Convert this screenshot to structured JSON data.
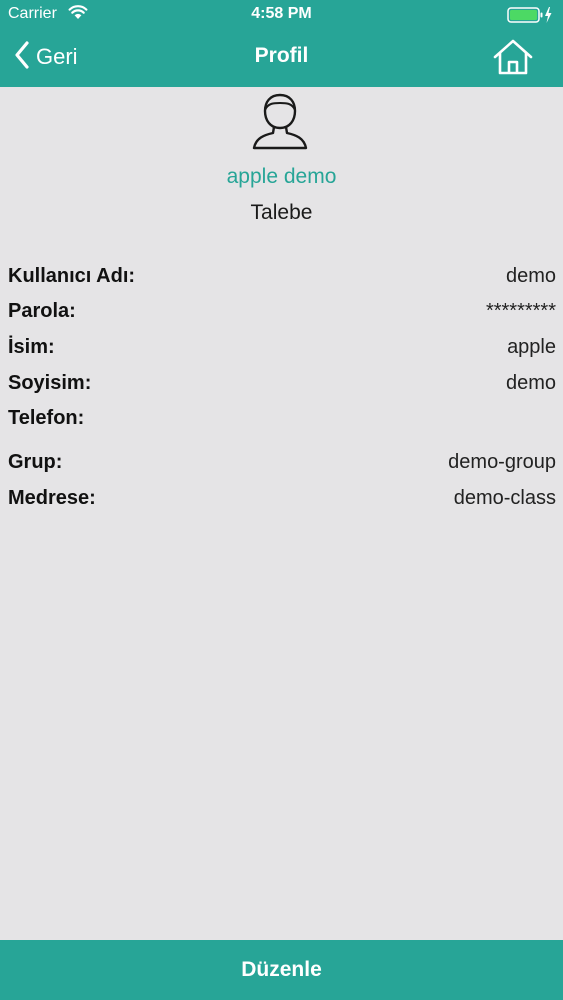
{
  "status_bar": {
    "carrier": "Carrier",
    "time": "4:58 PM"
  },
  "nav": {
    "back_label": "Geri",
    "title": "Profil"
  },
  "profile": {
    "name": "apple demo",
    "role": "Talebe"
  },
  "details": {
    "username_label": "Kullanıcı Adı:",
    "username_value": "demo",
    "password_label": "Parola:",
    "password_value": "*********",
    "first_name_label": "İsim:",
    "first_name_value": "apple",
    "last_name_label": "Soyisim:",
    "last_name_value": "demo",
    "phone_label": "Telefon:",
    "phone_value": "",
    "group_label": "Grup:",
    "group_value": "demo-group",
    "school_label": "Medrese:",
    "school_value": "demo-class"
  },
  "footer": {
    "edit_label": "Düzenle"
  },
  "colors": {
    "accent": "#27a597",
    "background": "#e5e4e6"
  },
  "icons": [
    "wifi-icon",
    "battery-icon",
    "charging-icon",
    "back-chevron-icon",
    "home-icon",
    "user-avatar-icon"
  ]
}
